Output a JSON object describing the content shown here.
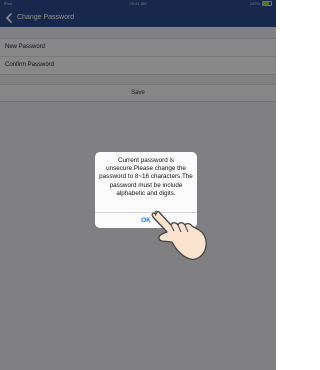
{
  "status_bar": {
    "carrier": "iPad",
    "time": "09:41 AM",
    "battery": "100%"
  },
  "nav": {
    "back_icon": "chevron-left-icon",
    "title": "Change Password"
  },
  "form": {
    "new_password_label": "New Password",
    "new_password_value": "",
    "confirm_password_label": "Confirm Password",
    "confirm_password_value": "",
    "save_label": "Save"
  },
  "alert": {
    "message": "Current password is unsecure.Please change the password to 8~16 characters.The password must be include alphabetic and digits.",
    "ok_label": "OK"
  },
  "pointer": {
    "icon": "hand-pointer-icon"
  },
  "colors": {
    "nav_bar": "#2c4a8a",
    "background": "#e9e9ee",
    "ok_button": "#1a7cf5",
    "battery": "#9bd44c"
  }
}
